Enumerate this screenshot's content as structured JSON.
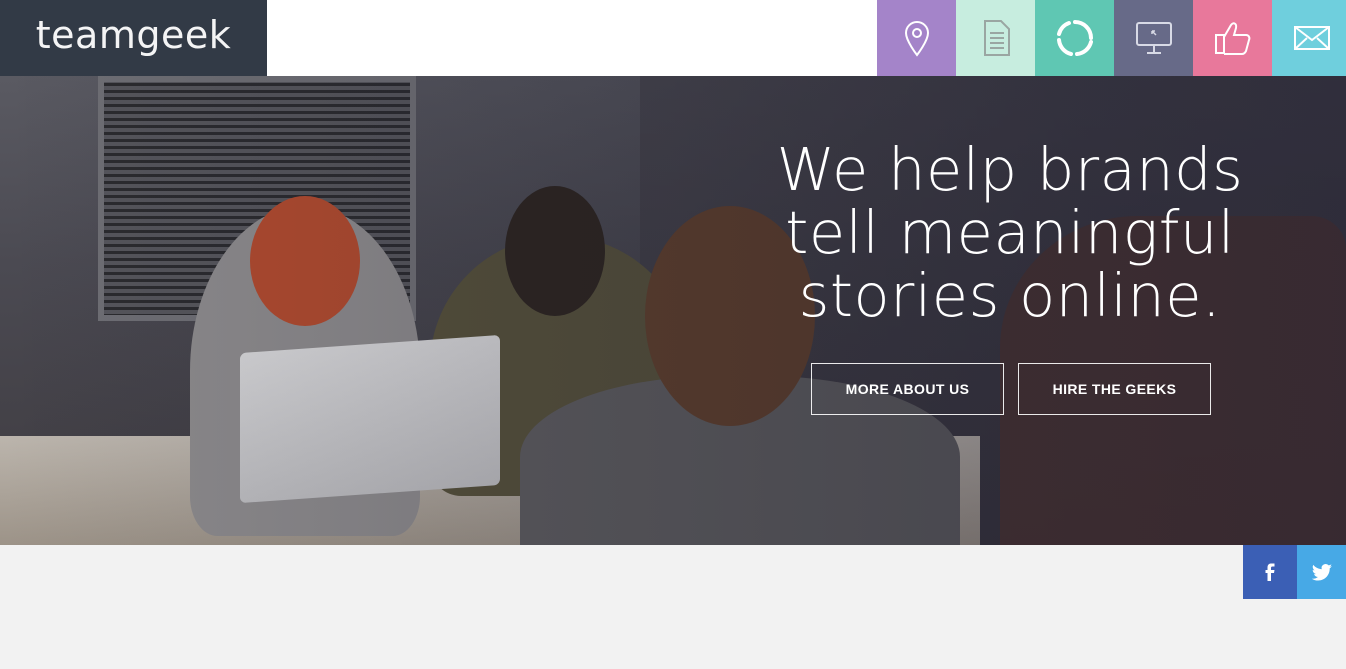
{
  "brand": {
    "logo_text": "teamgeek"
  },
  "nav": {
    "items": [
      {
        "icon": "map-pin-icon",
        "color": "#a484c9"
      },
      {
        "icon": "document-icon",
        "color": "#c7eddf"
      },
      {
        "icon": "refresh-circle-icon",
        "color": "#5fc7b3"
      },
      {
        "icon": "monitor-icon",
        "color": "#676a88"
      },
      {
        "icon": "thumbs-up-icon",
        "color": "#e8789b"
      },
      {
        "icon": "envelope-icon",
        "color": "#6fcfdd"
      }
    ]
  },
  "hero": {
    "headline_lines": [
      "We help brands",
      "tell meaningful",
      "stories online."
    ],
    "button_about": "MORE ABOUT US",
    "button_hire": "HIRE THE GEEKS"
  },
  "social": {
    "facebook": {
      "icon": "facebook-icon",
      "color": "#3b5fb5"
    },
    "twitter": {
      "icon": "twitter-icon",
      "color": "#47a9e6"
    }
  },
  "colors": {
    "header_logo_bg": "#323a46",
    "page_bg": "#f2f2f2"
  }
}
